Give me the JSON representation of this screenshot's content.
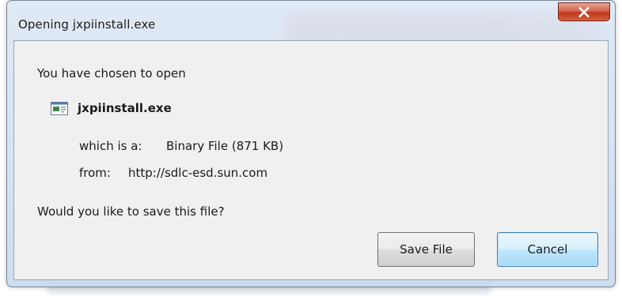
{
  "window": {
    "title": "Opening jxpiinstall.exe",
    "close_icon": "close-icon"
  },
  "dialog": {
    "intro": "You have chosen to open",
    "file_icon": "executable-file-icon",
    "file_name": "jxpiinstall.exe",
    "which_is_label": "which is a:",
    "which_is_value": "Binary File (871 KB)",
    "from_label": "from:",
    "from_value": "http://sdlc-esd.sun.com",
    "question": "Would you like to save this file?"
  },
  "buttons": {
    "save_label": "Save File",
    "cancel_label": "Cancel"
  },
  "colors": {
    "close_button": "#c0391c",
    "default_button_border": "#3c7fb1",
    "client_background": "#f0f0f0"
  }
}
